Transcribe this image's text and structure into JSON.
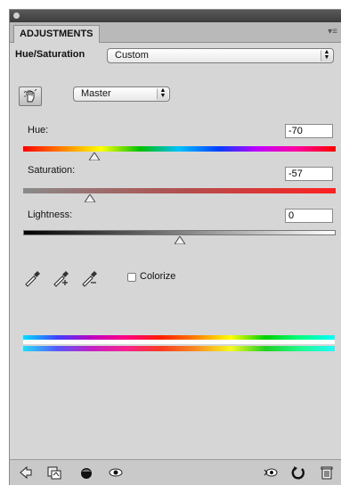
{
  "panel": {
    "tab_label": "ADJUSTMENTS",
    "menu_icon": "panel-menu-icon"
  },
  "adjustment": {
    "type_label": "Hue/Saturation",
    "preset_value": "Custom"
  },
  "channel": {
    "value": "Master"
  },
  "hue": {
    "label": "Hue:",
    "value": "-70",
    "slider_value": -70,
    "range": [
      -180,
      180
    ]
  },
  "saturation": {
    "label": "Saturation:",
    "value": "-57",
    "slider_value": -57,
    "range": [
      -100,
      100
    ]
  },
  "lightness": {
    "label": "Lightness:",
    "value": "0",
    "slider_value": 0,
    "range": [
      -100,
      100
    ]
  },
  "colorize": {
    "label": "Colorize",
    "checked": false
  },
  "bottom_icons": [
    "back-arrow-icon",
    "clip-to-layer-icon",
    "layer-visibility-circle-icon",
    "eye-icon",
    "view-previous-icon",
    "reset-icon",
    "trash-icon"
  ]
}
